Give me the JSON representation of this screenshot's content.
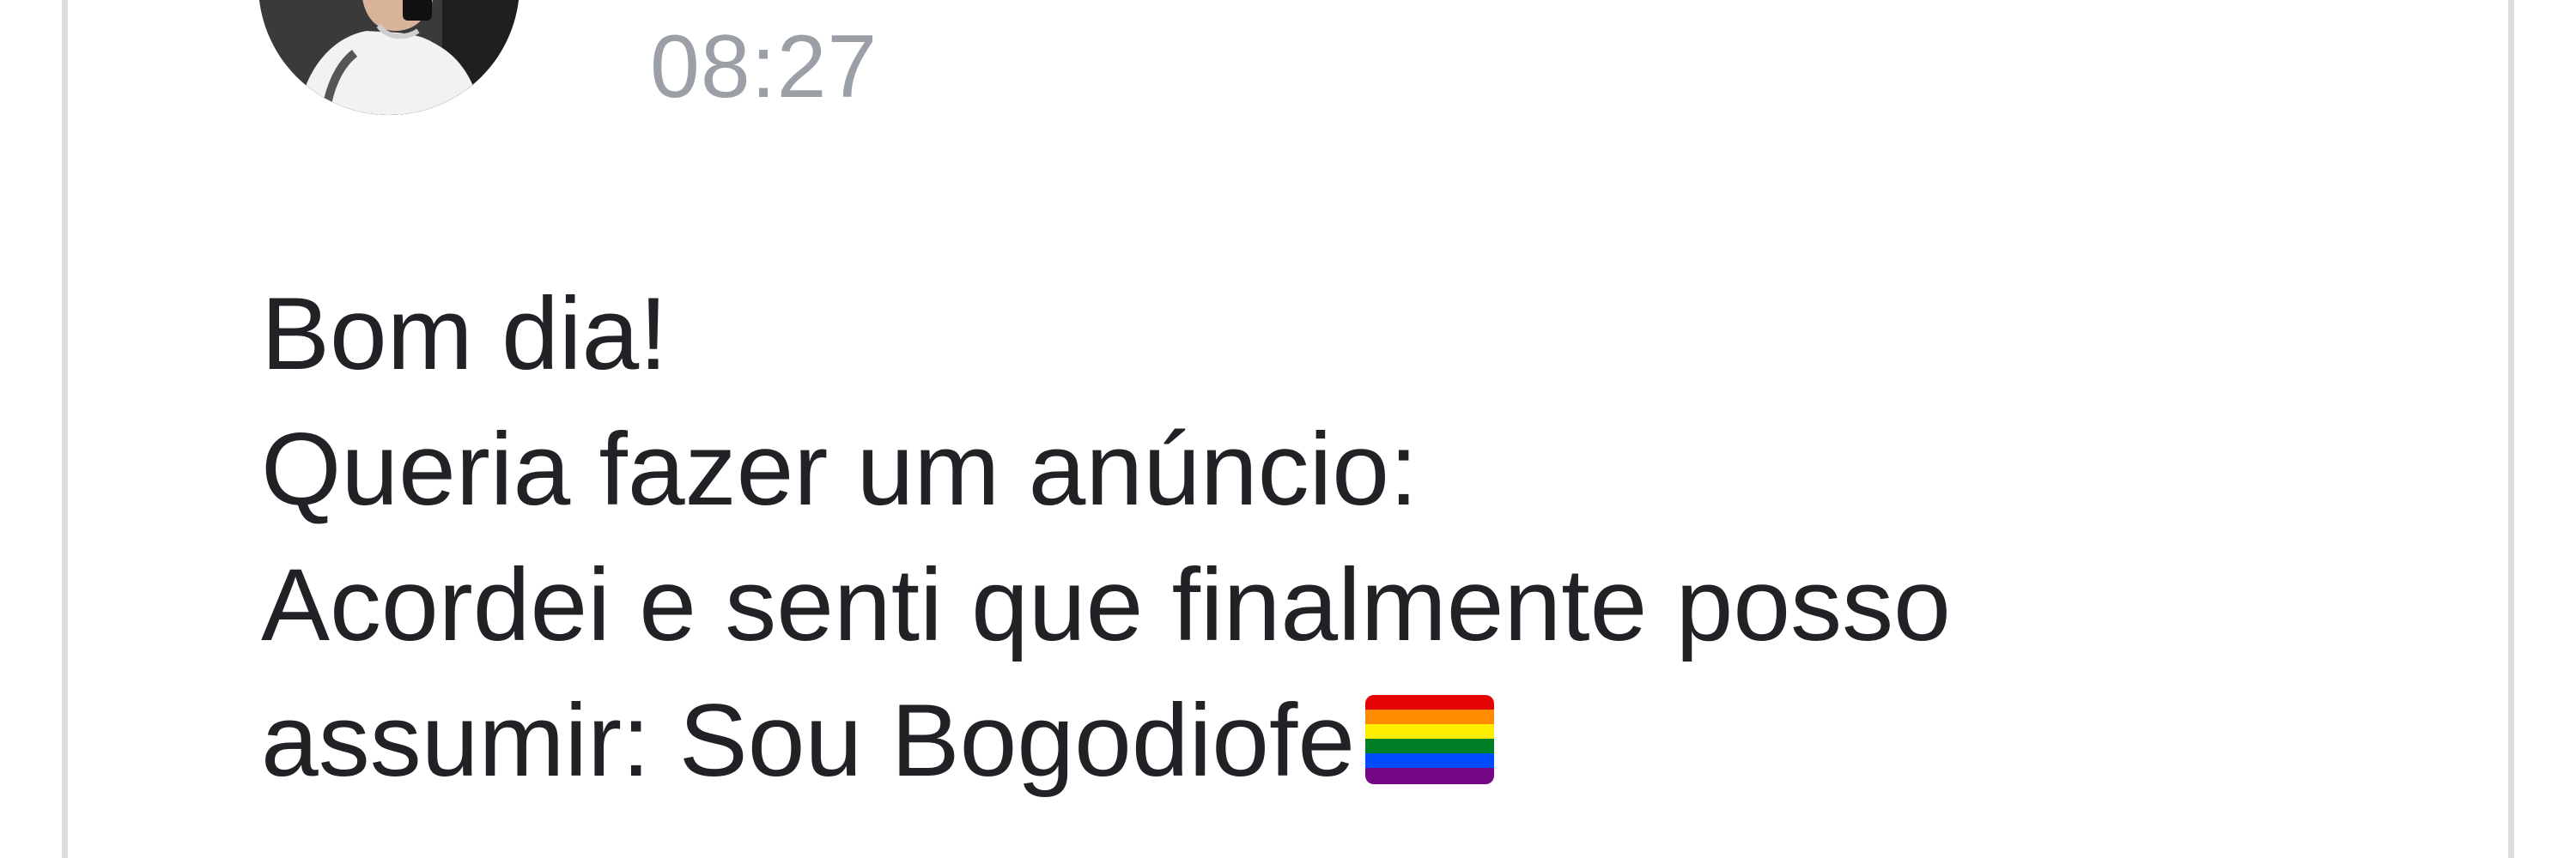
{
  "post": {
    "avatar_icon": "user-avatar-photo",
    "timestamp": "08:27",
    "message_lines": [
      "Bom dia!",
      "Queria fazer um anúncio:",
      "Acordei e senti que finalmente posso",
      "assumir: Sou Bogodiofe"
    ],
    "emoji_icon": "rainbow-flag-icon",
    "colors": {
      "timestamp": "#9aa0a6",
      "text": "#222226",
      "border": "#dedede"
    }
  }
}
